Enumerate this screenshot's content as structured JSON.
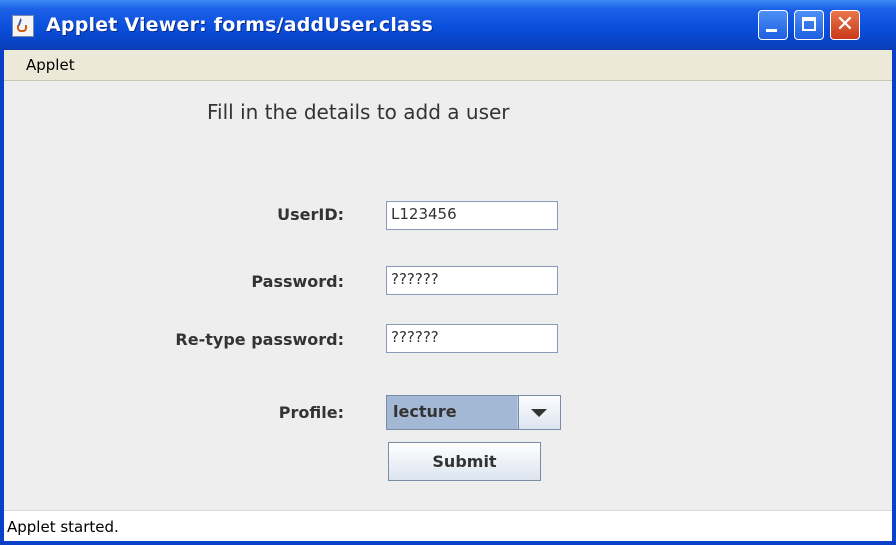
{
  "window": {
    "title": "Applet Viewer: forms/addUser.class"
  },
  "menu": {
    "items": [
      "Applet"
    ]
  },
  "form": {
    "heading": "Fill in the details to add a user",
    "userid_label": "UserID:",
    "userid_value": "L123456",
    "password_label": "Password:",
    "password_value": "??????",
    "retype_label": "Re-type password:",
    "retype_value": "??????",
    "profile_label": "Profile:",
    "profile_value": "lecture",
    "submit_label": "Submit"
  },
  "status": {
    "text": "Applet started."
  },
  "icons": {
    "app": "java-cup-icon",
    "minimize": "minimize-icon",
    "maximize": "maximize-icon",
    "close": "close-icon",
    "dropdown": "chevron-down-icon"
  },
  "colors": {
    "titlebar": "#0a4fdc",
    "close_button": "#c8391a",
    "panel": "#eeeeee",
    "combo_selected": "#a3b8d4"
  }
}
